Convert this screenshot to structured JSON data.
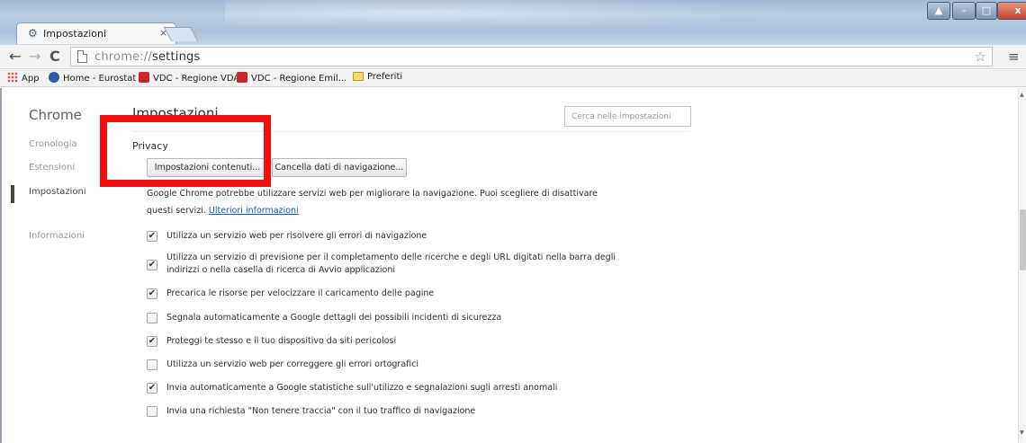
{
  "tab": {
    "icon": "gear-icon",
    "title": "Impostazioni",
    "close": "×"
  },
  "window_controls": {
    "close": "x"
  },
  "toolbar": {
    "back": "←",
    "forward": "→",
    "reload": "C",
    "url_scheme": "chrome://",
    "url_path": "settings",
    "star": "☆",
    "menu": "≡"
  },
  "bookmarks": [
    {
      "label": "App",
      "icon": "apps-grid-icon"
    },
    {
      "label": "Home - Eurostat",
      "icon": "eurostat-icon"
    },
    {
      "label": "VDC - Regione VDA",
      "icon": "vdc-icon"
    },
    {
      "label": "VDC - Regione Emil...",
      "icon": "vdc-icon"
    },
    {
      "label": "Preferiti",
      "icon": "folder-icon"
    }
  ],
  "sidebar": {
    "brand": "Chrome",
    "items": [
      {
        "label": "Cronologia",
        "active": false
      },
      {
        "label": "Estensioni",
        "active": false
      },
      {
        "label": "Impostazioni",
        "active": true
      },
      {
        "label": "Informazioni",
        "active": false
      }
    ]
  },
  "main": {
    "title": "Impostazioni",
    "search_placeholder": "Cerca nelle impostazioni",
    "section_title": "Privacy",
    "content_settings_button": "Impostazioni contenuti...",
    "clear_data_button": "Cancella dati di navigazione...",
    "description_part1": "Google Chrome potrebbe utilizzare servizi web per migliorare la navigazione. Puoi scegliere di disattivare questi servizi.",
    "learn_more": "Ulteriori informazioni"
  },
  "options": [
    {
      "label": "Utilizza un servizio web per risolvere gli errori di navigazione",
      "checked": true
    },
    {
      "label": "Utilizza un servizio di previsione per il completamento delle ricerche e degli URL digitati nella barra degli",
      "label_line2": "indirizzi o nella casella di ricerca di Avvio applicazioni",
      "checked": true
    },
    {
      "label": "Precarica le risorse per velocizzare il caricamento delle pagine",
      "checked": true
    },
    {
      "label": "Segnala automaticamente a Google dettagli dei possibili incidenti di sicurezza",
      "checked": false
    },
    {
      "label": "Proteggi te stesso e il tuo dispositivo da siti pericolosi",
      "checked": true
    },
    {
      "label": "Utilizza un servizio web per correggere gli errori ortografici",
      "checked": false
    },
    {
      "label": "Invia automaticamente a Google statistiche sull'utilizzo e segnalazioni sugli arresti anomali",
      "checked": true
    },
    {
      "label": "Invia una richiesta \"Non tenere traccia\" con il tuo traffico di navigazione",
      "checked": false
    }
  ],
  "checkmark": "✔",
  "colors": {
    "highlight": "#ef1010",
    "link": "#1255cc",
    "close_button": "#c2432c"
  }
}
